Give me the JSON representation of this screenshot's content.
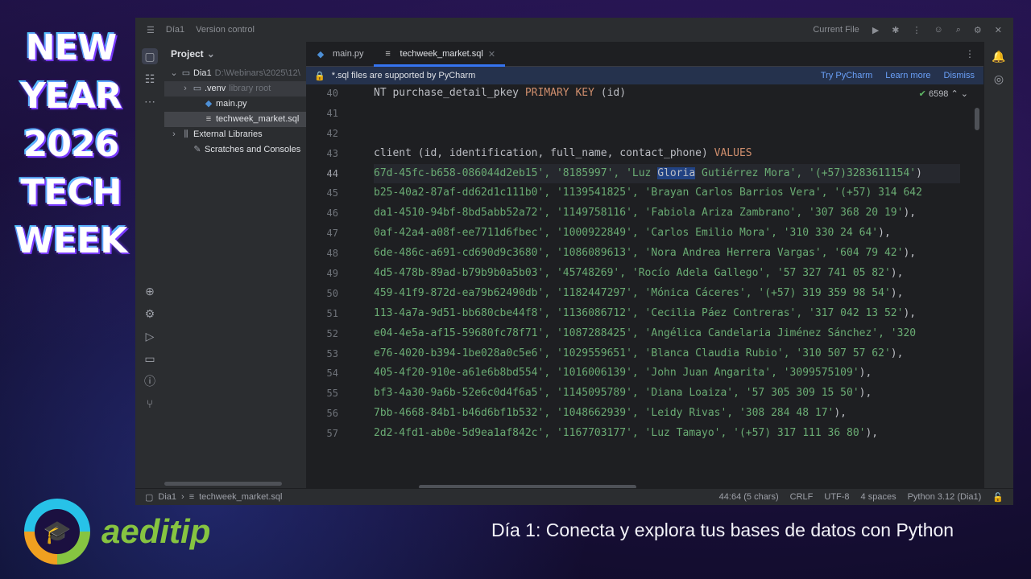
{
  "overlay": {
    "promo_title": [
      "NEW",
      "YEAR",
      "2026",
      "TECH",
      "WEEK"
    ],
    "brand_name": "aeditip",
    "subtitle": "Día 1: Conecta y explora tus bases de datos con Python"
  },
  "ide": {
    "titlebar": {
      "project_name": "Día1",
      "vcs_label": "Version control",
      "run_config": "Current File"
    },
    "project_panel": {
      "title": "Project",
      "tree": [
        {
          "label": "Dia1",
          "hint": "D:\\Webinars\\2025\\12\\",
          "icon": "folder-icon",
          "indent": 0,
          "expanded": true
        },
        {
          "label": ".venv",
          "hint": "library root",
          "icon": "folder-icon",
          "indent": 1,
          "expanded": false
        },
        {
          "label": "main.py",
          "hint": "",
          "icon": "python-file-icon",
          "indent": 2
        },
        {
          "label": "techweek_market.sql",
          "hint": "",
          "icon": "sql-file-icon",
          "indent": 2,
          "selected": true
        },
        {
          "label": "External Libraries",
          "hint": "",
          "icon": "library-icon",
          "indent": 0,
          "expanded": false
        },
        {
          "label": "Scratches and Consoles",
          "hint": "",
          "icon": "scratches-icon",
          "indent": 1
        }
      ]
    },
    "tabs": [
      {
        "label": "main.py",
        "active": false
      },
      {
        "label": "techweek_market.sql",
        "active": true
      }
    ],
    "banner": {
      "text": "*.sql files are supported by PyCharm",
      "actions": [
        "Try PyCharm",
        "Learn more",
        "Dismiss"
      ]
    },
    "inspection": {
      "count": "6598"
    },
    "code_lines": [
      {
        "n": "40",
        "segments": [
          {
            "t": "NT purchase_detail_pkey ",
            "c": ""
          },
          {
            "t": "PRIMARY KEY",
            "c": "kw"
          },
          {
            "t": " (id)",
            "c": ""
          }
        ]
      },
      {
        "n": "41",
        "segments": []
      },
      {
        "n": "42",
        "segments": []
      },
      {
        "n": "43",
        "segments": [
          {
            "t": "client (id, identification, full_name, contact_phone) ",
            "c": ""
          },
          {
            "t": "VALUES",
            "c": "kw"
          }
        ]
      },
      {
        "n": "44",
        "current": true,
        "segments": [
          {
            "t": "67d-45fc-b658-086044d2eb15', '8185997', 'Luz ",
            "c": "str"
          },
          {
            "t": "Gloria",
            "c": "hl"
          },
          {
            "t": " Gutiérrez Mora', '(+57)3283611154'",
            "c": "str"
          },
          {
            "t": ")",
            "c": ""
          }
        ]
      },
      {
        "n": "45",
        "segments": [
          {
            "t": "b25-40a2-87af-dd62d1c111b0', '1139541825', 'Brayan Carlos Barrios Vera', '(+57) 314 642",
            "c": "str"
          }
        ]
      },
      {
        "n": "46",
        "segments": [
          {
            "t": "da1-4510-94bf-8bd5abb52a72', '1149758116', 'Fabiola Ariza Zambrano', '307 368 20 19'",
            "c": "str"
          },
          {
            "t": "),",
            "c": ""
          }
        ]
      },
      {
        "n": "47",
        "segments": [
          {
            "t": "0af-42a4-a08f-ee7711d6fbec', '1000922849', 'Carlos Emilio Mora', '310 330 24 64'",
            "c": "str"
          },
          {
            "t": "),",
            "c": ""
          }
        ]
      },
      {
        "n": "48",
        "segments": [
          {
            "t": "6de-486c-a691-cd690d9c3680', '1086089613', 'Nora Andrea Herrera Vargas', '604 79 42'",
            "c": "str"
          },
          {
            "t": "),",
            "c": ""
          }
        ]
      },
      {
        "n": "49",
        "segments": [
          {
            "t": "4d5-478b-89ad-b79b9b0a5b03', '45748269', 'Rocío Adela Gallego', '57 327 741 05 82'",
            "c": "str"
          },
          {
            "t": "),",
            "c": ""
          }
        ]
      },
      {
        "n": "50",
        "segments": [
          {
            "t": "459-41f9-872d-ea79b62490db', '1182447297', 'Mónica Cáceres', '(+57) 319 359 98 54'",
            "c": "str"
          },
          {
            "t": "),",
            "c": ""
          }
        ]
      },
      {
        "n": "51",
        "segments": [
          {
            "t": "113-4a7a-9d51-bb680cbe44f8', '1136086712', 'Cecilia Páez Contreras', '317 042 13 52'",
            "c": "str"
          },
          {
            "t": "),",
            "c": ""
          }
        ]
      },
      {
        "n": "52",
        "segments": [
          {
            "t": "e04-4e5a-af15-59680fc78f71', '1087288425', 'Angélica Candelaria Jiménez Sánchez', '320",
            "c": "str"
          }
        ]
      },
      {
        "n": "53",
        "segments": [
          {
            "t": "e76-4020-b394-1be028a0c5e6', '1029559651', 'Blanca Claudia Rubio', '310 507 57 62'",
            "c": "str"
          },
          {
            "t": "),",
            "c": ""
          }
        ]
      },
      {
        "n": "54",
        "segments": [
          {
            "t": "405-4f20-910e-a61e6b8bd554', '1016006139', 'John Juan Angarita', '3099575109'",
            "c": "str"
          },
          {
            "t": "),",
            "c": ""
          }
        ]
      },
      {
        "n": "55",
        "segments": [
          {
            "t": "bf3-4a30-9a6b-52e6c0d4f6a5', '1145095789', 'Diana Loaiza', '57 305 309 15 50'",
            "c": "str"
          },
          {
            "t": "),",
            "c": ""
          }
        ]
      },
      {
        "n": "56",
        "segments": [
          {
            "t": "7bb-4668-84b1-b46d6bf1b532', '1048662939', 'Leidy Rivas', '308 284 48 17'",
            "c": "str"
          },
          {
            "t": "),",
            "c": ""
          }
        ]
      },
      {
        "n": "57",
        "segments": [
          {
            "t": "2d2-4fd1-ab0e-5d9ea1af842c', '1167703177', 'Luz Tamayo', '(+57) 317 111 36 80'",
            "c": "str"
          },
          {
            "t": "),",
            "c": ""
          }
        ]
      }
    ],
    "statusbar": {
      "breadcrumb": [
        "Dia1",
        "techweek_market.sql"
      ],
      "position": "44:64 (5 chars)",
      "line_sep": "CRLF",
      "encoding": "UTF-8",
      "indent": "4 spaces",
      "interpreter": "Python 3.12 (Dia1)"
    }
  },
  "colors": {
    "keyword": "#cf8e6d",
    "string": "#6aab73",
    "selection": "#214283",
    "accent": "#3574f0",
    "brand": "#86c441"
  }
}
